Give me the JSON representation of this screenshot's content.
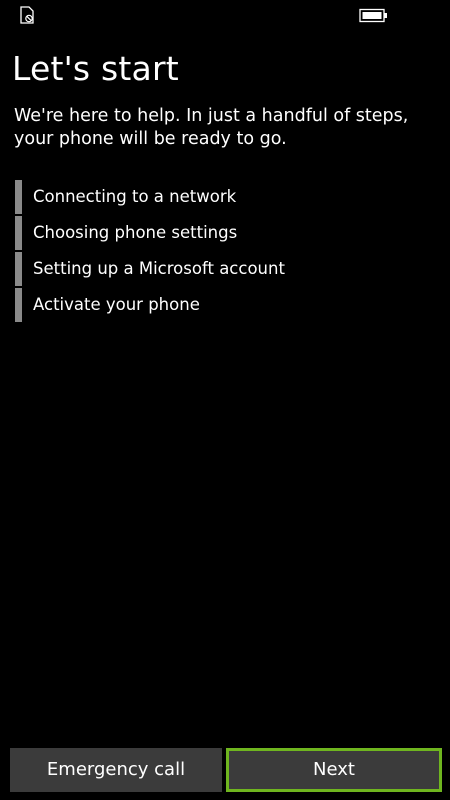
{
  "status_bar": {
    "left_icon": "sim-blocked-icon",
    "right_icon": "battery-icon"
  },
  "page": {
    "title": "Let's start",
    "intro": "We're here to help. In just a handful of steps, your phone will be ready to go."
  },
  "steps": [
    {
      "label": "Connecting to a network"
    },
    {
      "label": "Choosing phone settings"
    },
    {
      "label": "Setting up a Microsoft account"
    },
    {
      "label": "Activate your phone"
    }
  ],
  "buttons": {
    "emergency_label": "Emergency call",
    "next_label": "Next"
  },
  "colors": {
    "background": "#000000",
    "text": "#ffffff",
    "step_bar": "#8a8a8a",
    "button": "#3b3b3b",
    "accent": "#6fb51f"
  }
}
